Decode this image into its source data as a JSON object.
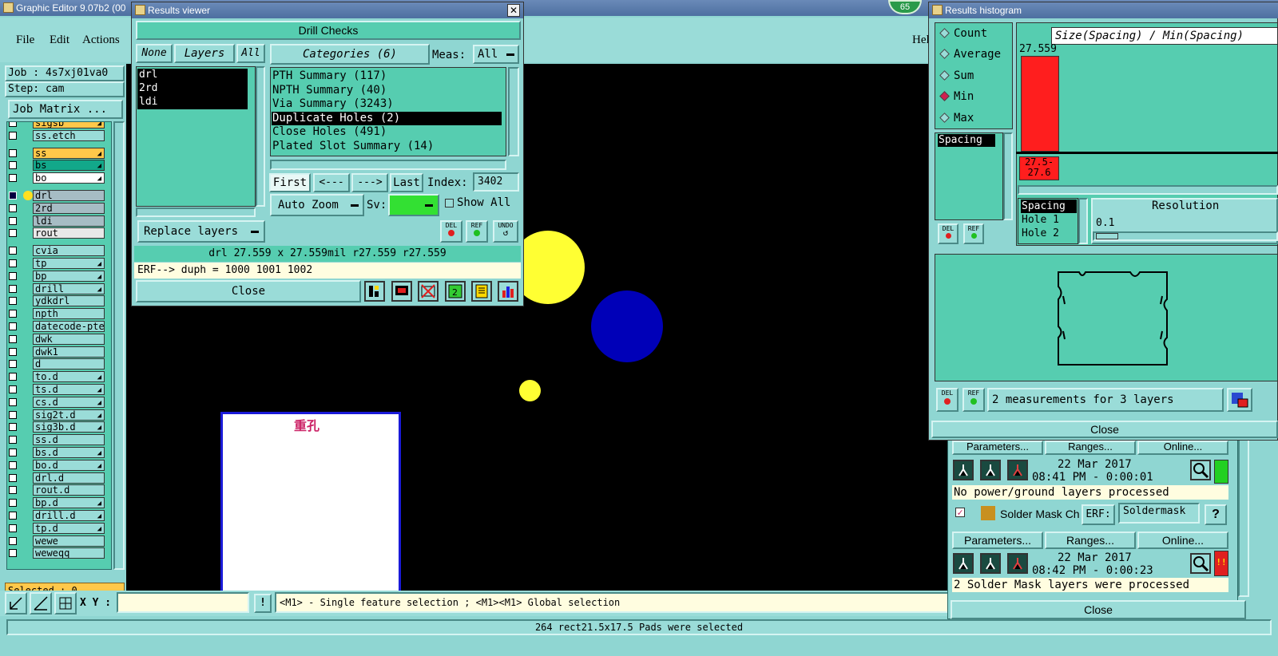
{
  "main": {
    "title": "Graphic Editor 9.07b2 (00",
    "menu": [
      "File",
      "Edit",
      "Actions"
    ],
    "help": "Help",
    "job_label": "Job : 4s7xj01va0",
    "step_label": "Step: cam",
    "job_matrix": "Job Matrix ...",
    "layers_group1": [
      "sigsb",
      "ss.etch"
    ],
    "layers_group2": [
      "ss",
      "bs",
      "bo"
    ],
    "layers_group3": [
      "drl",
      "2rd",
      "ldi",
      "rout"
    ],
    "layers_group4": [
      "cvia",
      "tp",
      "bp",
      "drill",
      "ydkdrl",
      "npth",
      "datecode-pte",
      "dwk",
      "dwk1",
      "d",
      "to.d",
      "ts.d",
      "cs.d",
      "sig2t.d",
      "sig3b.d",
      "ss.d",
      "bs.d",
      "bo.d",
      "drl.d",
      "rout.d",
      "bp.d",
      "drill.d",
      "tp.d",
      "wewe",
      "weweqq"
    ],
    "selected": "Selected : 0",
    "xy_label": "X Y :",
    "hint": "<M1> - Single feature selection ; <M1><M1> Global selection",
    "status": "264 rect21.5x17.5 Pads were selected",
    "badge": "65",
    "canvas_label": "重孔",
    "colors": {
      "yellow": "#ffff33",
      "blue": "#0000b8",
      "canvas": "#000000",
      "label": "#cc2266"
    }
  },
  "results_viewer": {
    "title": "Results viewer",
    "header": "Drill Checks",
    "btn_none": "None",
    "btn_layers": "Layers",
    "btn_all": "All",
    "categories_label": "Categories (6)",
    "meas_label": "Meas:",
    "meas_value": "All",
    "layers": [
      "drl",
      "2rd",
      "ldi"
    ],
    "categories": [
      "PTH Summary (117)",
      "NPTH Summary (40)",
      "Via Summary (3243)",
      "Duplicate Holes (2)",
      "Close Holes (491)",
      "Plated Slot Summary (14)"
    ],
    "nav": {
      "first": "First",
      "prev": "<---",
      "next": "--->",
      "last": "Last",
      "index_label": "Index:",
      "index_value": "3402"
    },
    "auto_zoom": "Auto Zoom",
    "sv_label": "Sv:",
    "show_all": "Show All",
    "replace_layers": "Replace layers",
    "icon_del": "DEL",
    "icon_ref": "REF",
    "icon_undo": "UNDO",
    "info": "drl 27.559 x 27.559mil  r27.559  r27.559",
    "erf": "ERF--> duph = 1000 1001 1002",
    "close": "Close"
  },
  "histogram": {
    "title": "Results histogram",
    "options": [
      "Count",
      "Average",
      "Sum",
      "Min",
      "Max"
    ],
    "selected_option": "Min",
    "axis_title": "Size(Spacing) / Min(Spacing)",
    "bar_value": "27.559",
    "bar_range_top": "27.5-",
    "bar_range_bottom": "27.6",
    "list1": [
      "Spacing"
    ],
    "list2": [
      "Spacing",
      "Hole 1",
      "Hole 2"
    ],
    "resolution_label": "Resolution",
    "resolution_value": "0.1",
    "measurements": "2 measurements for 3 layers",
    "close": "Close",
    "icon_del": "DEL",
    "icon_ref": "REF"
  },
  "checklist": {
    "params": "Parameters...",
    "ranges": "Ranges...",
    "online": "Online...",
    "run1_date": "22 Mar 2017",
    "run1_time": "08:41 PM - 0:00:01",
    "run1_msg": "No power/ground layers processed",
    "solder_label": "Solder Mask Ch",
    "erf_label": "ERF:",
    "erf_value": "Soldermask",
    "help_q": "?",
    "run2_date": "22 Mar 2017",
    "run2_time": "08:42 PM - 0:00:23",
    "run2_msg": "2 Solder Mask layers were processed",
    "close": "Close",
    "warn": "!!"
  }
}
